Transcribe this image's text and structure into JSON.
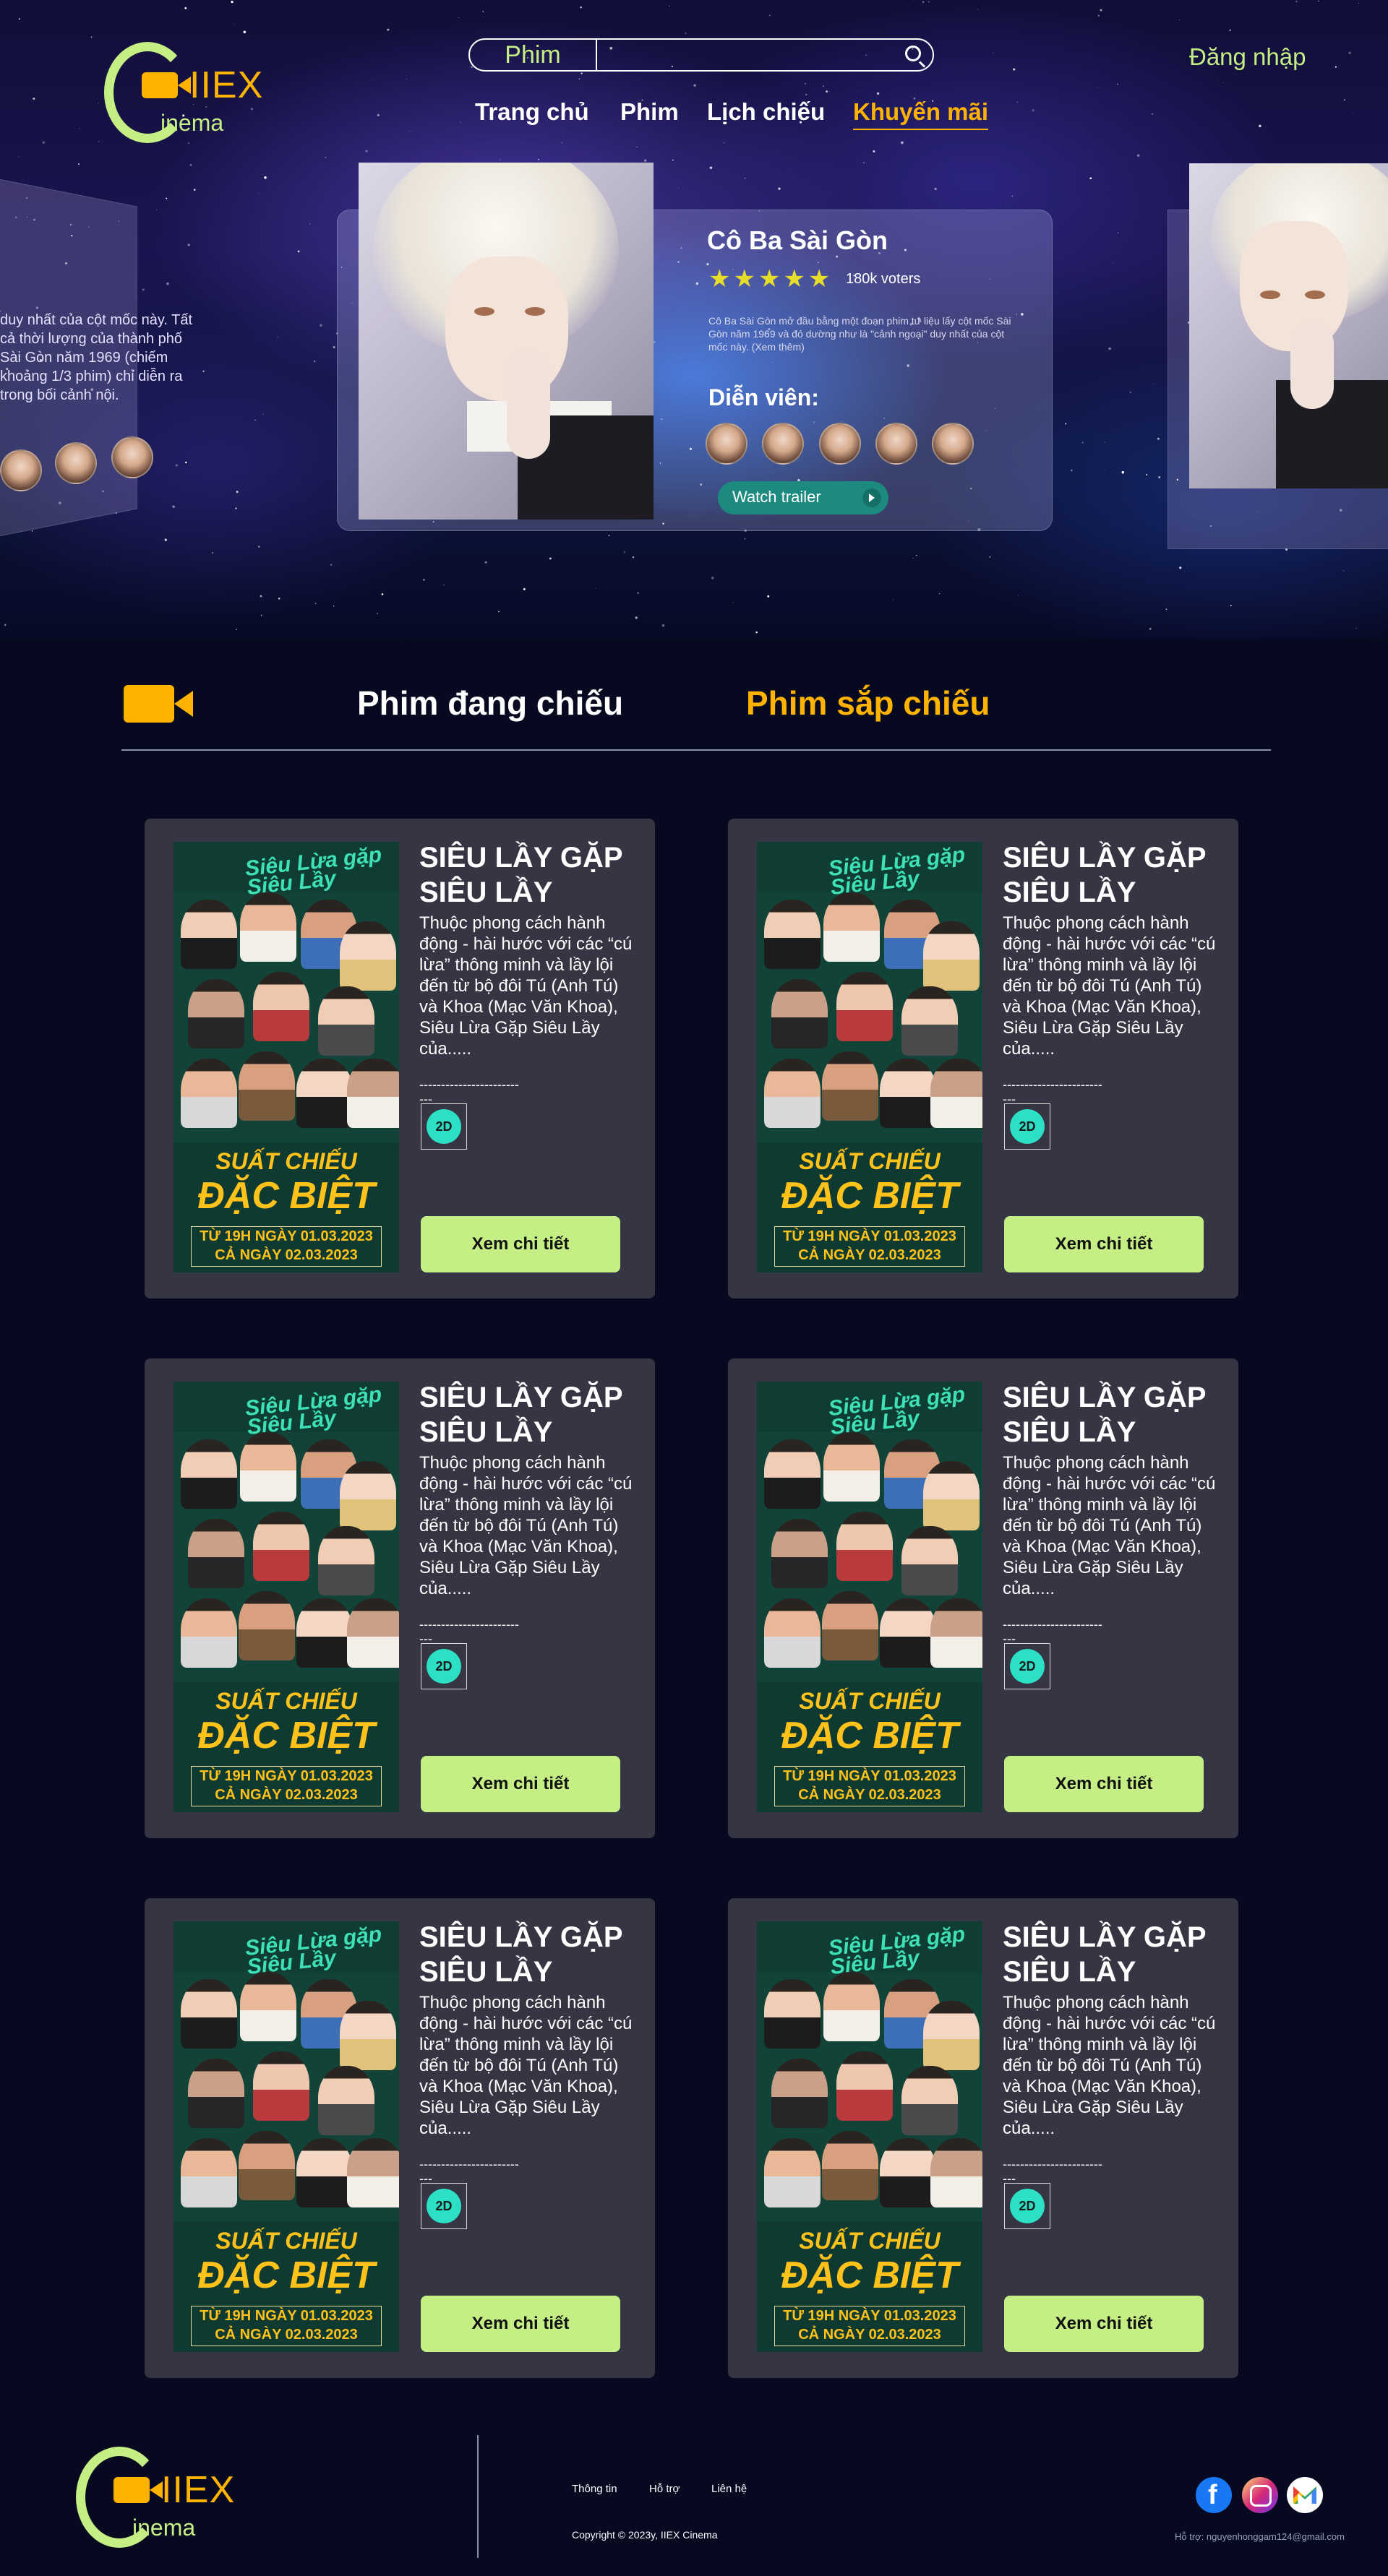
{
  "header": {
    "logo_main": "IIEX",
    "logo_sub": "inema",
    "search_category": "Phim",
    "search_value": "",
    "nav": [
      "Trang chủ",
      "Phim",
      "Lịch chiếu",
      "Khuyến mãi"
    ],
    "nav_active": "Khuyến mãi",
    "login": "Đăng nhập"
  },
  "hero": {
    "left_card_text": "duy nhất của cột mốc này. Tất cả thời lượng của thành phố Sài Gòn năm 1969 (chiếm khoảng 1/3 phim) chỉ diễn ra trong bối cảnh nội.",
    "title": "Cô Ba Sài Gòn",
    "stars": "★★★★★",
    "rating": 5,
    "voters": "180k voters",
    "description": "Cô Ba Sài Gòn mở đầu bằng một đoạn phim tư liệu lấy cột mốc Sài Gòn năm 1969 và đó dường như là \"cảnh ngoại\" duy nhất của cột mốc này. (Xem thêm)",
    "cast_label": "Diễn viên:",
    "cast_count": 5,
    "trailer_label": "Watch trailer"
  },
  "listing": {
    "tabs": [
      "Phim đang chiếu",
      "Phim sắp chiếu"
    ],
    "active_tab": "Phim sắp chiếu",
    "cards": [
      {
        "title": "SIÊU LẦY GẶP SIÊU LẦY",
        "description": "Thuộc phong cách hành động - hài hước với các “cú lừa” thông minh và lầy lội đến từ bộ đôi Tú (Anh Tú) và Khoa (Mạc Văn Khoa), Siêu Lừa Gặp Siêu Lầy của.....",
        "dashes": "-----------------------",
        "dashes2": "---",
        "format": "2D",
        "button": "Xem chi tiết",
        "poster_logo": "Siêu Lừa gặp Siêu Lầy",
        "poster_l1": "SUẤT CHIẾU",
        "poster_l2": "ĐẶC BIỆT",
        "poster_l3": "TỪ 19H NGÀY 01.03.2023",
        "poster_l4": "CẢ NGÀY 02.03.2023"
      },
      {
        "title": "SIÊU LẦY GẶP SIÊU LẦY",
        "description": "Thuộc phong cách hành động - hài hước với các “cú lừa” thông minh và lầy lội đến từ bộ đôi Tú (Anh Tú) và Khoa (Mạc Văn Khoa), Siêu Lừa Gặp Siêu Lầy của.....",
        "dashes": "-----------------------",
        "dashes2": "---",
        "format": "2D",
        "button": "Xem chi tiết",
        "poster_logo": "Siêu Lừa gặp Siêu Lầy",
        "poster_l1": "SUẤT CHIẾU",
        "poster_l2": "ĐẶC BIỆT",
        "poster_l3": "TỪ 19H NGÀY 01.03.2023",
        "poster_l4": "CẢ NGÀY 02.03.2023"
      },
      {
        "title": "SIÊU LẦY GẶP SIÊU LẦY",
        "description": "Thuộc phong cách hành động - hài hước với các “cú lừa” thông minh và lầy lội đến từ bộ đôi Tú (Anh Tú) và Khoa (Mạc Văn Khoa), Siêu Lừa Gặp Siêu Lầy của.....",
        "dashes": "-----------------------",
        "dashes2": "---",
        "format": "2D",
        "button": "Xem chi tiết",
        "poster_logo": "Siêu Lừa gặp Siêu Lầy",
        "poster_l1": "SUẤT CHIẾU",
        "poster_l2": "ĐẶC BIỆT",
        "poster_l3": "TỪ 19H NGÀY 01.03.2023",
        "poster_l4": "CẢ NGÀY 02.03.2023"
      },
      {
        "title": "SIÊU LẦY GẶP SIÊU LẦY",
        "description": "Thuộc phong cách hành động - hài hước với các “cú lừa” thông minh và lầy lội đến từ bộ đôi Tú (Anh Tú) và Khoa (Mạc Văn Khoa), Siêu Lừa Gặp Siêu Lầy của.....",
        "dashes": "-----------------------",
        "dashes2": "---",
        "format": "2D",
        "button": "Xem chi tiết",
        "poster_logo": "Siêu Lừa gặp Siêu Lầy",
        "poster_l1": "SUẤT CHIẾU",
        "poster_l2": "ĐẶC BIỆT",
        "poster_l3": "TỪ 19H NGÀY 01.03.2023",
        "poster_l4": "CẢ NGÀY 02.03.2023"
      },
      {
        "title": "SIÊU LẦY GẶP SIÊU LẦY",
        "description": "Thuộc phong cách hành động - hài hước với các “cú lừa” thông minh và lầy lội đến từ bộ đôi Tú (Anh Tú) và Khoa (Mạc Văn Khoa), Siêu Lừa Gặp Siêu Lầy của.....",
        "dashes": "-----------------------",
        "dashes2": "---",
        "format": "2D",
        "button": "Xem chi tiết",
        "poster_logo": "Siêu Lừa gặp Siêu Lầy",
        "poster_l1": "SUẤT CHIẾU",
        "poster_l2": "ĐẶC BIỆT",
        "poster_l3": "TỪ 19H NGÀY 01.03.2023",
        "poster_l4": "CẢ NGÀY 02.03.2023"
      },
      {
        "title": "SIÊU LẦY GẶP SIÊU LẦY",
        "description": "Thuộc phong cách hành động - hài hước với các “cú lừa” thông minh và lầy lội đến từ bộ đôi Tú (Anh Tú) và Khoa (Mạc Văn Khoa), Siêu Lừa Gặp Siêu Lầy của.....",
        "dashes": "-----------------------",
        "dashes2": "---",
        "format": "2D",
        "button": "Xem chi tiết",
        "poster_logo": "Siêu Lừa gặp Siêu Lầy",
        "poster_l1": "SUẤT CHIẾU",
        "poster_l2": "ĐẶC BIỆT",
        "poster_l3": "TỪ 19H NGÀY 01.03.2023",
        "poster_l4": "CẢ NGÀY 02.03.2023"
      }
    ]
  },
  "footer": {
    "links": [
      "Thông tin",
      "Hỗ trợ",
      "Liên hệ"
    ],
    "copyright": "Copyright © 2023y, IIEX Cinema",
    "support": "Hỗ trợ: nguyenhonggam124@gmail.com",
    "social": [
      "facebook-icon",
      "instagram-icon",
      "gmail-icon"
    ]
  },
  "colors": {
    "accent": "#ffb300",
    "lime": "#c5ef84",
    "card_bg": "#353543",
    "page_bg": "#06091f",
    "badge": "#2be0c5",
    "trailer": "#1d8a80"
  }
}
